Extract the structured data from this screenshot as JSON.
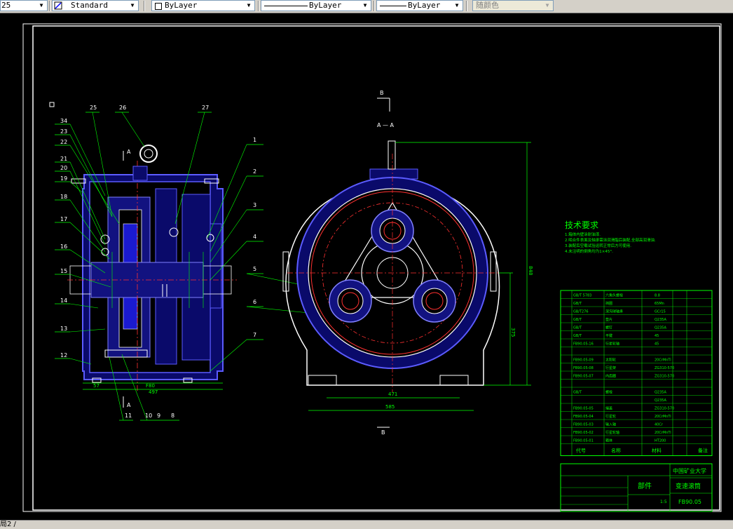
{
  "toolbar": {
    "text_style_value": "25",
    "dim_style_value": "Standard",
    "layer_color_value": "ByLayer",
    "linetype_value": "ByLayer",
    "lineweight_value": "ByLayer",
    "plotstyle_value": "随颜色"
  },
  "status": {
    "text": "局2 /"
  },
  "drawing": {
    "leaders_left": [
      "34",
      "23",
      "22",
      "21",
      "20",
      "19",
      "18",
      "17",
      "16",
      "15",
      "14",
      "13",
      "12"
    ],
    "leaders_top": [
      "25",
      "26",
      "27"
    ],
    "leaders_right": [
      "1",
      "2",
      "3",
      "4",
      "5",
      "6",
      "7"
    ],
    "leaders_bottom": [
      "11",
      "10",
      "9",
      "8"
    ],
    "section_label": "A",
    "section_view_label": "A — A",
    "section_b_label": "B",
    "dims": {
      "left_small": "57",
      "left_mid": "F80",
      "left_total": "497",
      "right_inner": "471",
      "right_total": "585",
      "right_height": "848",
      "right_center": "375"
    },
    "tech_title": "技术要求",
    "tech_lines": [
      "1.箱体内壁涂耐油漆.",
      "2.啮合件表面及轴承需涂润滑脂后装配,全部高润滑油.",
      "3.装配后空载试验运转正常后方可使用.",
      "4.未注明的倒角均为1×45°."
    ],
    "bom_rows": [
      [
        "GB/T 5783",
        "六角头螺栓",
        "",
        "8.8"
      ],
      [
        "GB/T",
        "挡圈",
        "",
        "65Mn"
      ],
      [
        "GB/T276",
        "深沟球轴承",
        "",
        "GCr15"
      ],
      [
        "GB/T",
        "垫片",
        "",
        "Q235A"
      ],
      [
        "GB/T",
        "螺钉",
        "",
        "Q235A"
      ],
      [
        "GB/T",
        "平键",
        "",
        "45"
      ],
      [
        "FB90.05-16",
        "行星轮轴",
        "",
        "45"
      ],
      [
        "",
        "",
        "",
        ""
      ],
      [
        "FB90.05-09",
        "太阳轮",
        "",
        "20CrMnTi"
      ],
      [
        "FB90.05-08",
        "行星架",
        "",
        "ZG310-570"
      ],
      [
        "FB90.05-07",
        "内齿圈",
        "",
        "ZG310-570"
      ],
      [
        "",
        "",
        "",
        ""
      ],
      [
        "GB/T",
        "螺栓",
        "",
        "Q235A"
      ],
      [
        "",
        "",
        "",
        "Q235A"
      ],
      [
        "FB90.05-05",
        "端盖",
        "",
        "ZG310-570"
      ],
      [
        "FB90.05-04",
        "行星轮",
        "",
        "20CrMnTi"
      ],
      [
        "FB90.05-03",
        "输入轴",
        "",
        "40Cr"
      ],
      [
        "FB90.05-02",
        "行星轮轴",
        "",
        "20CrMnTi"
      ],
      [
        "FB90.05-01",
        "箱体",
        "",
        "HT200"
      ]
    ],
    "bom_header": [
      "代号",
      "名称",
      "材料",
      "备注"
    ],
    "title_part": "部件",
    "title_school": "中国矿业大学",
    "title_name": "变速滚筒",
    "title_code": "FB90.05",
    "title_scale": "1:5"
  }
}
